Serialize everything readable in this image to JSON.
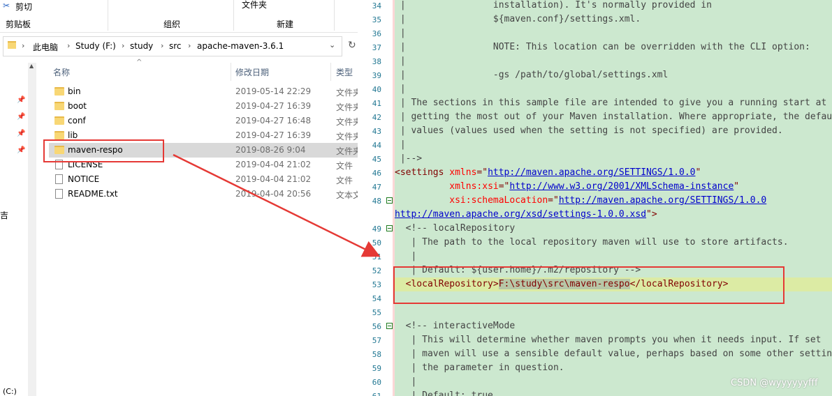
{
  "ribbon": {
    "cut_label": "剪切",
    "clipboard_label": "剪贴板",
    "folder_label": "文件夹",
    "organize_label": "组织",
    "new_label": "新建"
  },
  "address": {
    "crumbs": [
      "此电脑",
      "Study (F:)",
      "study",
      "src",
      "apache-maven-3.6.1"
    ]
  },
  "file_list": {
    "headers": {
      "name": "名称",
      "date": "修改日期",
      "type": "类型"
    },
    "rows": [
      {
        "name": "bin",
        "date": "2019-05-14 22:29",
        "type": "文件夹",
        "kind": "folder"
      },
      {
        "name": "boot",
        "date": "2019-04-27 16:39",
        "type": "文件夹",
        "kind": "folder"
      },
      {
        "name": "conf",
        "date": "2019-04-27 16:48",
        "type": "文件夹",
        "kind": "folder"
      },
      {
        "name": "lib",
        "date": "2019-04-27 16:39",
        "type": "文件夹",
        "kind": "folder"
      },
      {
        "name": "maven-respo",
        "date": "2019-08-26 9:04",
        "type": "文件夹",
        "kind": "folder"
      },
      {
        "name": "LICENSE",
        "date": "2019-04-04 21:02",
        "type": "文件",
        "kind": "file"
      },
      {
        "name": "NOTICE",
        "date": "2019-04-04 21:02",
        "type": "文件",
        "kind": "file"
      },
      {
        "name": "README.txt",
        "date": "2019-04-04 20:56",
        "type": "文本文",
        "kind": "file"
      }
    ]
  },
  "nav_stub": {
    "side_char": "吉",
    "drive": "(C:)"
  },
  "editor": {
    "line_numbers": [
      "34",
      "35",
      "36",
      "37",
      "38",
      "39",
      "40",
      "41",
      "42",
      "43",
      "44",
      "45",
      "46",
      "47",
      "48",
      "",
      "49",
      "50",
      "51",
      "52",
      "53",
      "54",
      "55",
      "56",
      "57",
      "58",
      "59",
      "60",
      "61"
    ],
    "lines": {
      "l34": " |                installation). It's normally provided in",
      "l35": " |                ${maven.conf}/settings.xml.",
      "l36": " |",
      "l37": " |                NOTE: This location can be overridden with the CLI option:",
      "l38": " |",
      "l39": " |                -gs /path/to/global/settings.xml",
      "l40": " |",
      "l41": " | The sections in this sample file are intended to give you a running start at",
      "l42": " | getting the most out of your Maven installation. Where appropriate, the default",
      "l43": " | values (values used when the setting is not specified) are provided.",
      "l44": " |",
      "l45": " |-->",
      "l46_tag": "<settings ",
      "l46_attr": "xmlns",
      "l46_val": "http://maven.apache.org/SETTINGS/1.0.0",
      "l47_attr": "xmlns:xsi",
      "l47_val": "http://www.w3.org/2001/XMLSchema-instance",
      "l48_attr": "xsi:schemaLocation",
      "l48_val": "http://maven.apache.org/SETTINGS/1.0.0",
      "l48b_val": "http://maven.apache.org/xsd/settings-1.0.0.xsd",
      "l49": "  <!-- localRepository",
      "l50": "   | The path to the local repository maven will use to store artifacts.",
      "l51": "   |",
      "l52": "   | Default: ${user.home}/.m2/repository -->",
      "l53_open": "<localRepository>",
      "l53_value": "F:\\study\\src\\maven-respo",
      "l53_close": "</localRepository>",
      "l56": "  <!-- interactiveMode",
      "l57": "   | This will determine whether maven prompts you when it needs input. If set",
      "l58": "   | maven will use a sensible default value, perhaps based on some other setting",
      "l59": "   | the parameter in question.",
      "l60": "   |",
      "l61": "   | Default: true"
    }
  },
  "watermark": "CSDN @wyyyyyyfff",
  "colors": {
    "annotation_red": "#e53935",
    "editor_bg": "#cce8cf",
    "line_highlight": "#dceba4"
  }
}
